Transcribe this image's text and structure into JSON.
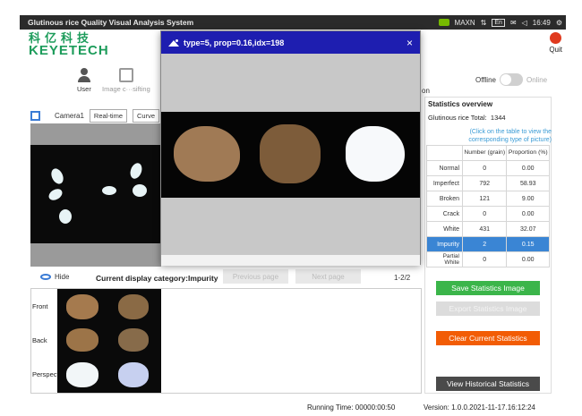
{
  "system_bar": {
    "title": "Glutinous rice Quality Visual Analysis System",
    "tray_network": "MAXN",
    "tray_lang": "En",
    "time": "16:49"
  },
  "logo": {
    "cn": "科亿科技",
    "en": "KEYETECH"
  },
  "quit_label": "Quit",
  "nav": {
    "user_label": "User",
    "image_label": "Image c···sifting"
  },
  "mode": {
    "offline": "Offline",
    "online": "Online",
    "stub": "on"
  },
  "camera": {
    "name": "Camera1",
    "tabs": [
      "Real-time",
      "Curve"
    ]
  },
  "modal": {
    "title": "type=5, prop=0.16,idx=198",
    "close": "×"
  },
  "bottom": {
    "hide": "Hide",
    "category": "Current display category:Impurity",
    "prev": "Previous page",
    "next": "Next page",
    "page": "1-2/2",
    "sides": [
      "Front",
      "Back",
      "Perspect"
    ]
  },
  "stats": {
    "title": "Statistics overview",
    "total_label": "Glutinous rice Total:",
    "total_value": "1344",
    "hint": "(Click on the table to view the corresponding type of picture)",
    "headers": [
      "Number (grain)",
      "Proportion (%)"
    ],
    "rows": [
      {
        "label": "Normal",
        "number": "0",
        "proportion": "0.00"
      },
      {
        "label": "Imperfect",
        "number": "792",
        "proportion": "58.93"
      },
      {
        "label": "Broken",
        "number": "121",
        "proportion": "9.00"
      },
      {
        "label": "Crack",
        "number": "0",
        "proportion": "0.00"
      },
      {
        "label": "White",
        "number": "431",
        "proportion": "32.07"
      },
      {
        "label": "Impurity",
        "number": "2",
        "proportion": "0.15"
      },
      {
        "label": "Partial White",
        "number": "0",
        "proportion": "0.00"
      }
    ],
    "selected_row": "Impurity"
  },
  "buttons": {
    "save_image": "Save Statistics Image",
    "export_image": "Export Statistics Image",
    "clear": "Clear Current Statistics",
    "history": "View Historical Statistics"
  },
  "footer": {
    "running": "Running Time: 00000:00:50",
    "version": "Version: 1.0.0.2021-11-17.16:12:24"
  },
  "colors": {
    "green_button": "#3bb54a",
    "orange_button": "#f25c05",
    "dark_button": "#4a4a4a",
    "selected_row": "#3a85d4",
    "modal_header": "#1e1eb0"
  }
}
